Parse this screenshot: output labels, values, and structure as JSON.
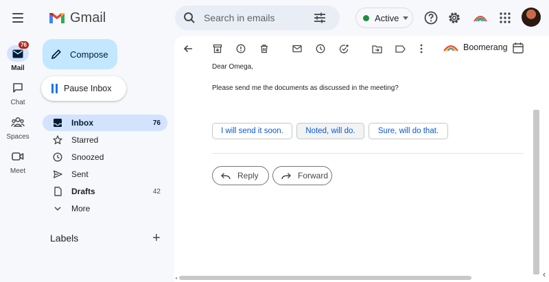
{
  "app": {
    "name": "Gmail"
  },
  "search": {
    "placeholder": "Search in emails"
  },
  "status": {
    "label": "Active",
    "color": "#1e8e3e"
  },
  "rail": {
    "mail": {
      "label": "Mail",
      "badge": "76"
    },
    "chat": {
      "label": "Chat"
    },
    "spaces": {
      "label": "Spaces"
    },
    "meet": {
      "label": "Meet"
    }
  },
  "compose": {
    "label": "Compose"
  },
  "pause_inbox": {
    "label": "Pause Inbox"
  },
  "nav": {
    "inbox": {
      "label": "Inbox",
      "count": "76"
    },
    "starred": {
      "label": "Starred"
    },
    "snoozed": {
      "label": "Snoozed"
    },
    "sent": {
      "label": "Sent"
    },
    "drafts": {
      "label": "Drafts",
      "count": "42"
    },
    "more": {
      "label": "More"
    }
  },
  "labels": {
    "title": "Labels"
  },
  "toolbar": {
    "boomerang_label": "Boomerang"
  },
  "email": {
    "greeting": "Dear Omega,",
    "body": "Please send me the documents as discussed in the meeting?"
  },
  "smart_replies": [
    "I will send it soon.",
    "Noted, will do.",
    "Sure, will do that."
  ],
  "actions": {
    "reply": "Reply",
    "forward": "Forward"
  },
  "colors": {
    "accent": "#0b57d0",
    "compose_bg": "#c2e7ff",
    "active_nav": "#d3e3fd",
    "badge": "#b3261e"
  }
}
